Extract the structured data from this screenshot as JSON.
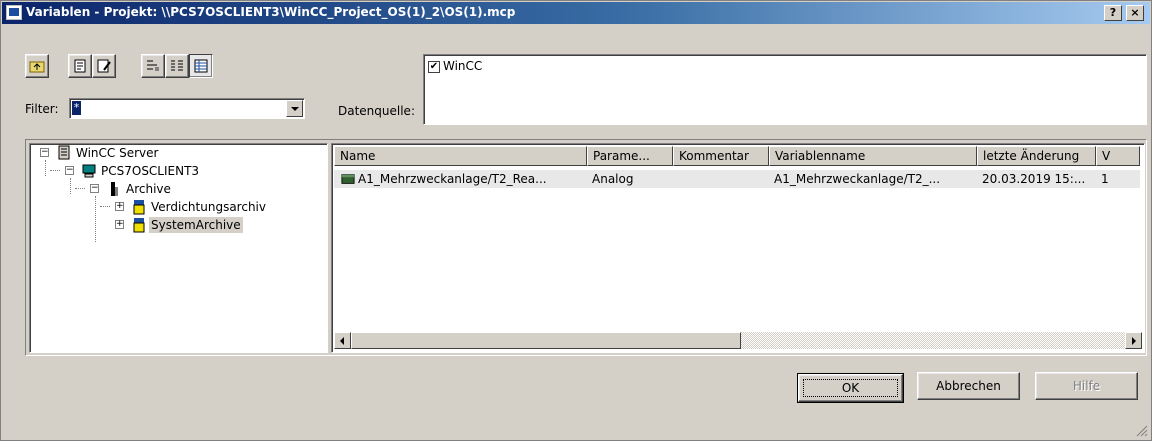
{
  "window": {
    "title": "Variablen - Projekt: \\\\PCS7OSCLIENT3\\WinCC_Project_OS(1)_2\\OS(1).mcp",
    "help_label": "?",
    "close_label": "×"
  },
  "toolbar": {
    "icons": [
      "up-folder-icon",
      "insert-icon",
      "edit-icon",
      "large-icons-view-icon",
      "small-icons-view-icon",
      "details-view-icon"
    ]
  },
  "filter": {
    "label": "Filter:",
    "value": "*"
  },
  "datasource": {
    "label": "Datenquelle:",
    "items": [
      {
        "label": "WinCC",
        "checked": true,
        "check_glyph": "✔"
      }
    ]
  },
  "tree": {
    "root": {
      "label": "WinCC Server",
      "expander": "−"
    },
    "client": {
      "label": "PCS7OSCLIENT3",
      "expander": "−"
    },
    "archive": {
      "label": "Archive",
      "expander": "−"
    },
    "children": [
      {
        "label": "Verdichtungsarchiv",
        "expander": "+"
      },
      {
        "label": "SystemArchive",
        "expander": "+",
        "selected": true
      }
    ]
  },
  "list": {
    "columns": [
      "Name",
      "Parame...",
      "Kommentar",
      "Variablenname",
      "letzte Änderung",
      "V"
    ],
    "rows": [
      {
        "name": "A1_Mehrzweckanlage/T2_Rea...",
        "param": "Analog",
        "comment": "",
        "varname": "A1_Mehrzweckanlage/T2_...",
        "changed": "20.03.2019 15:...",
        "v": "1"
      }
    ]
  },
  "buttons": {
    "ok": "OK",
    "cancel": "Abbrechen",
    "help": "Hilfe"
  },
  "colors": {
    "face": "#d4d0c8",
    "title_active": "#0a246a",
    "selection": "#0a246a"
  }
}
